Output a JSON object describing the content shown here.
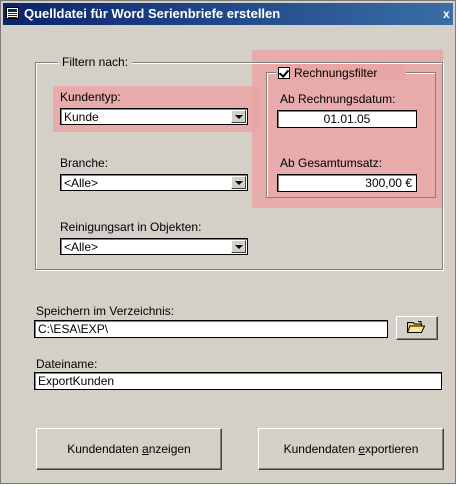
{
  "window": {
    "title": "Quelldatei für Word Serienbriefe erstellen",
    "close_glyph": "x"
  },
  "filter_group": {
    "legend": "Filtern nach:",
    "kundentyp": {
      "label": "Kundentyp:",
      "value": "Kunde"
    },
    "branche": {
      "label": "Branche:",
      "value": "<Alle>"
    },
    "reinigungsart": {
      "label": "Reinigungsart in Objekten:",
      "value": "<Alle>"
    }
  },
  "rechnungsfilter": {
    "checkbox_label": "Rechnungsfilter",
    "checked": true,
    "ab_datum": {
      "label": "Ab Rechnungsdatum:",
      "value": "01.01.05"
    },
    "ab_umsatz": {
      "label": "Ab Gesamtumsatz:",
      "value": "300,00 €"
    }
  },
  "speichern": {
    "label": "Speichern im Verzeichnis:",
    "value": "C:\\ESA\\EXP\\",
    "browse_icon": "folder-open-icon"
  },
  "dateiname": {
    "label": "Dateiname:",
    "value": "ExportKunden"
  },
  "buttons": {
    "anzeigen_pre": "Kundendaten ",
    "anzeigen_hot": "a",
    "anzeigen_post": "nzeigen",
    "exportieren_pre": "Kundendaten ",
    "exportieren_hot": "e",
    "exportieren_post": "xportieren"
  },
  "colors": {
    "highlight": "#e8a6a6",
    "titlebar_start": "#0a246a",
    "titlebar_end": "#3a6ea5",
    "dialog_bg": "#d4d0c8"
  }
}
